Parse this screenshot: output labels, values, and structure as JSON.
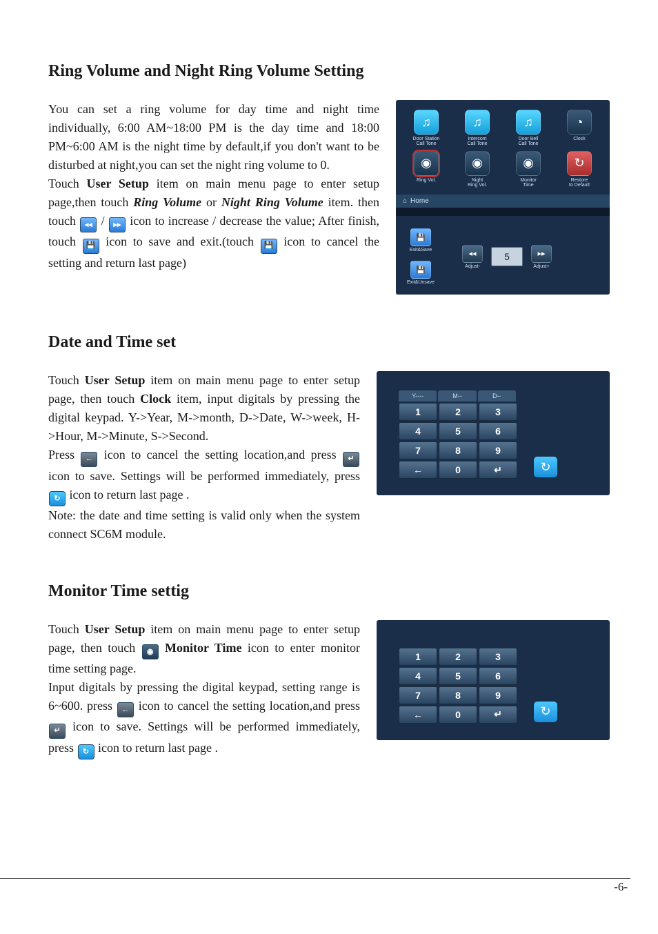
{
  "page_number": "-6-",
  "sections": [
    {
      "title": "Ring Volume and Night Ring Volume Setting",
      "p1a": "You can set a ring volume for day time and night time individually, 6:00 AM~18:00 PM is the day time and 18:00 PM~6:00 AM is the night time by default,if you don't want to be disturbed at night,you can set the night ring volume to 0.",
      "p2_touch": "Touch ",
      "p2_user_setup": "User Setup",
      "p2_a": " item on main menu page to enter setup page,then touch ",
      "p2_ring_vol": "Ring Volume",
      "p2_or": " or ",
      "p2_night_ring": "Night Ring Volume",
      "p2_b": " item. then touch ",
      "p2_slash": " / ",
      "p2_c": " icon to increase / decrease the value;  After finish, touch ",
      "p2_d": " icon to save and exit.(touch ",
      "p2_e": " icon to cancel the setting and return last page)"
    },
    {
      "title": "Date and Time set",
      "p1_touch": "Touch ",
      "p1_user_setup": "User Setup",
      "p1_a": " item on main menu page to enter setup page, then touch ",
      "p1_clock": "Clock",
      "p1_b": " item, input digitals by pressing the digital keypad. Y->Year, M->month, D->Date, W->week, H->Hour, M->Minute, S->Second.",
      "p2_press": "Press ",
      "p2_a": " icon to cancel the setting location,and press ",
      "p2_b": " icon to save. Settings will be performed immediately, press ",
      "p2_c": " icon to  return last page .",
      "note": "Note: the date and time setting is valid only when the system connect SC6M module."
    },
    {
      "title": "Monitor Time settig",
      "p1_touch": "Touch ",
      "p1_user_setup": "User Setup",
      "p1_a": " item on main menu page to enter setup page, then touch ",
      "p1_monitor_time": " Monitor Time",
      "p1_b": " icon to enter monitor time setting page.",
      "p2_a": "Input digitals by pressing the digital keypad, setting range is 6~600. press ",
      "p2_b": " icon to cancel the setting location,and press ",
      "p2_c": " icon to save. Settings will be performed immediately, press ",
      "p2_d": " icon to  return last page ."
    }
  ],
  "ui1": {
    "icons": [
      {
        "label": "Door Station\nCall Tone",
        "glyph": "♫",
        "style": "cyan"
      },
      {
        "label": "Intercom\nCall Tone",
        "glyph": "♫",
        "style": "cyan"
      },
      {
        "label": "Door Bell\nCall Tone",
        "glyph": "♫",
        "style": "cyan"
      },
      {
        "label": "Clock",
        "glyph": "◔",
        "style": "dark"
      },
      {
        "label": "Ring Vol.",
        "glyph": "◉",
        "style": "dark",
        "selected": true
      },
      {
        "label": "Night\nRing Vol.",
        "glyph": "◉",
        "style": "dark"
      },
      {
        "label": "Monitor\nTime",
        "glyph": "◉",
        "style": "dark"
      },
      {
        "label": "Restore\nto Default",
        "glyph": "↻",
        "style": "red"
      }
    ],
    "home_label": "Home",
    "exit_save": "Exit&Save",
    "exit_unsave": "Exit&Unsave",
    "adjust_minus": "Adjust-",
    "adjust_plus": "Adjust+",
    "value": "5"
  },
  "ui2": {
    "date_header": [
      "Y----",
      "M--",
      "D--"
    ],
    "keys": [
      "1",
      "2",
      "3",
      "4",
      "5",
      "6",
      "7",
      "8",
      "9",
      "←",
      "0",
      "↵"
    ]
  },
  "ui3": {
    "keys": [
      "1",
      "2",
      "3",
      "4",
      "5",
      "6",
      "7",
      "8",
      "9",
      "←",
      "0",
      "↵"
    ]
  }
}
